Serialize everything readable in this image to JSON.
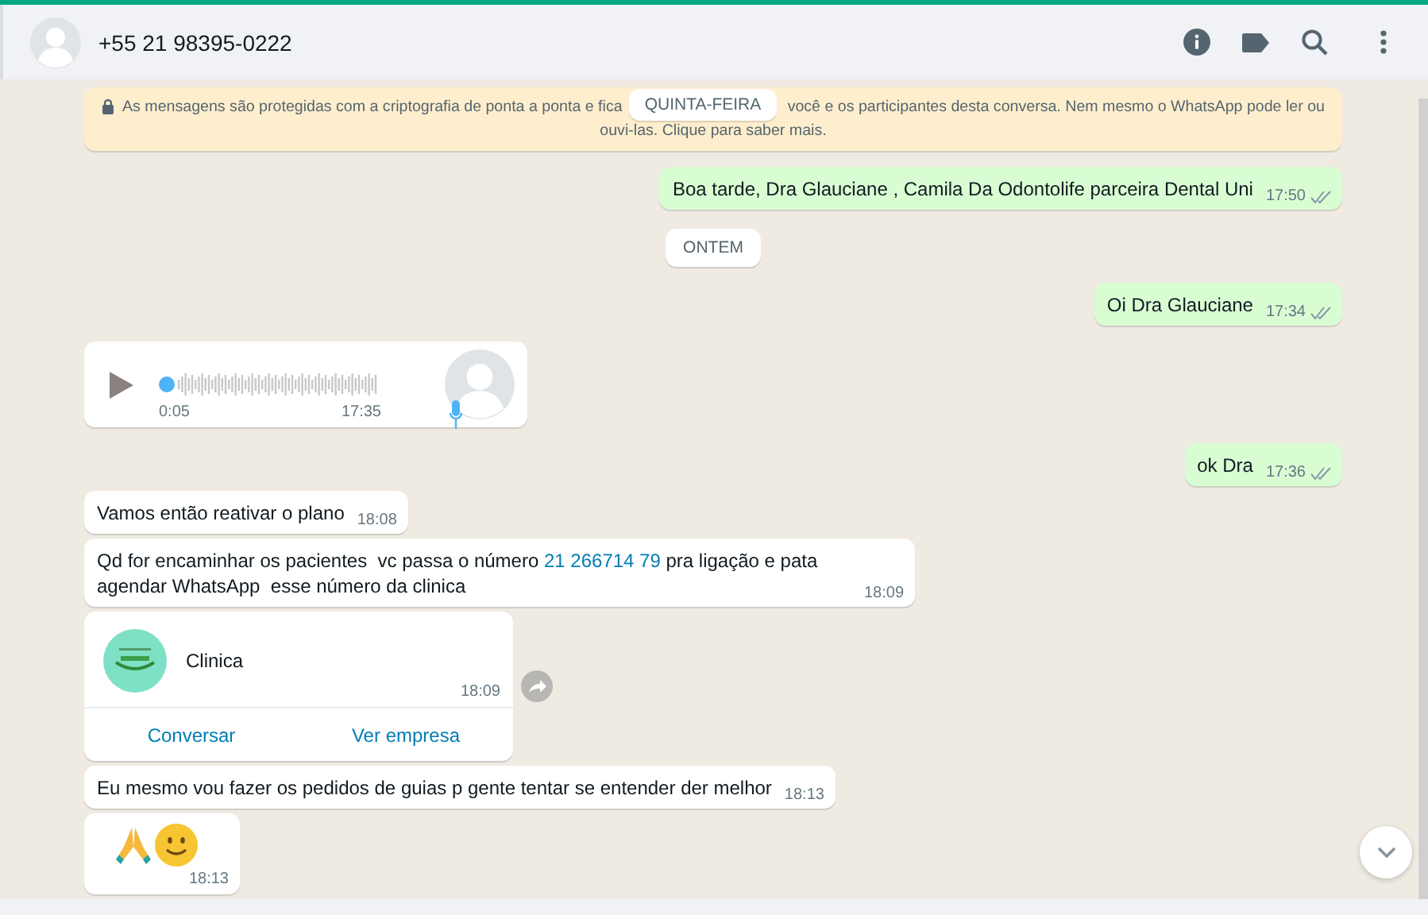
{
  "header": {
    "contact": "+55 21 98395-0222"
  },
  "encryption_notice": {
    "line_1": [
      "As mensagens são protegidas com a criptografia de ponta a ponta e fica",
      "você e os participantes desta conversa. Nem mesmo o WhatsApp pode ler ou"
    ],
    "line_2": "ouvi-las. Clique para saber mais."
  },
  "floating_date": "QUINTA-FEIRA",
  "messages": [
    {
      "kind": "text",
      "outgoing": true,
      "parts": [
        {
          "text": "Boa tarde, Dra Glauciane , Camila Da Odontolife parceira Dental Uni",
          "link": false
        }
      ],
      "time": "17:50",
      "read": false
    },
    {
      "kind": "date",
      "label": "ONTEM"
    },
    {
      "kind": "text",
      "outgoing": true,
      "parts": [
        {
          "text": "Oi Dra Glauciane",
          "link": false
        }
      ],
      "time": "17:34",
      "read": false
    },
    {
      "kind": "voice",
      "outgoing": false,
      "duration": "0:05",
      "time": "17:35"
    },
    {
      "kind": "text",
      "outgoing": true,
      "parts": [
        {
          "text": "ok Dra",
          "link": false
        }
      ],
      "time": "17:36",
      "read": false
    },
    {
      "kind": "text",
      "outgoing": false,
      "parts": [
        {
          "text": "Vamos então reativar o plano",
          "link": false
        }
      ],
      "time": "18:08"
    },
    {
      "kind": "text",
      "outgoing": false,
      "parts": [
        {
          "text": "Qd for encaminhar os pacientes  vc passa o número ",
          "link": false
        },
        {
          "text": "21 266714 79",
          "link": true
        },
        {
          "text": " pra ligação e pata agendar WhatsApp  esse número da clinica",
          "link": false
        }
      ],
      "time": "18:09"
    },
    {
      "kind": "contact",
      "outgoing": false,
      "name": "Clinica",
      "time": "18:09",
      "actions": [
        "Conversar",
        "Ver empresa"
      ]
    },
    {
      "kind": "text",
      "outgoing": false,
      "parts": [
        {
          "text": "Eu mesmo vou fazer os pedidos de guias p gente tentar se entender der melhor",
          "link": false
        }
      ],
      "time": "18:13"
    },
    {
      "kind": "emoji",
      "outgoing": false,
      "time": "18:13"
    }
  ]
}
